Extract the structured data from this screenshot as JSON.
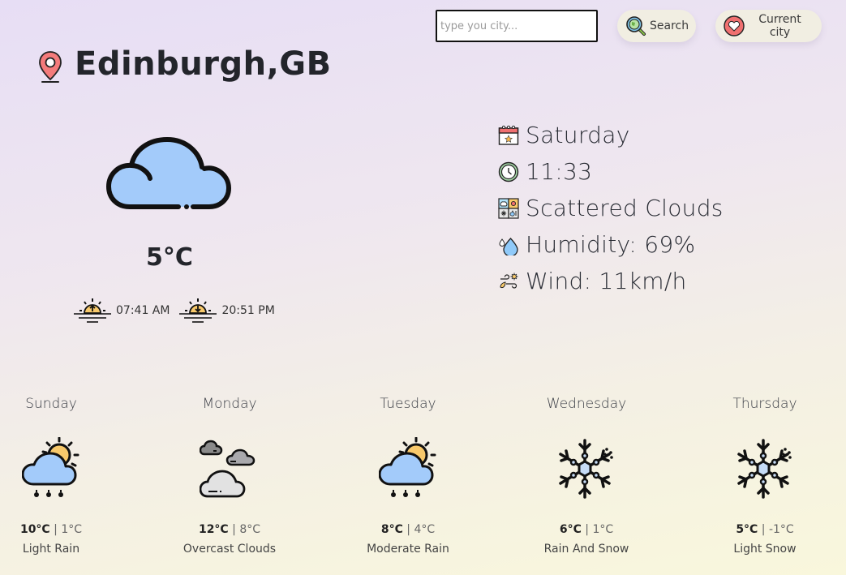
{
  "search": {
    "placeholder": "type you city...",
    "value": "",
    "search_label": "Search",
    "current_city_label": "Current city"
  },
  "location": {
    "title": "Edinburgh,GB"
  },
  "current": {
    "temperature": "5°C",
    "sunrise": "07:41 AM",
    "sunset": "20:51 PM",
    "day": "Saturday",
    "time": "11:33",
    "condition": "Scattered Clouds",
    "humidity": "Humidity: 69%",
    "wind": "Wind: 11km/h"
  },
  "forecast": [
    {
      "day": "Sunday",
      "high": "10°C",
      "low": "1°C",
      "desc": "Light Rain",
      "icon": "sun-cloud-rain-icon"
    },
    {
      "day": "Monday",
      "high": "12°C",
      "low": "8°C",
      "desc": "Overcast Clouds",
      "icon": "overcast-clouds-icon"
    },
    {
      "day": "Tuesday",
      "high": "8°C",
      "low": "4°C",
      "desc": "Moderate Rain",
      "icon": "sun-cloud-rain-icon"
    },
    {
      "day": "Wednesday",
      "high": "6°C",
      "low": "1°C",
      "desc": "Rain And Snow",
      "icon": "snowflake-icon"
    },
    {
      "day": "Thursday",
      "high": "5°C",
      "low": "-1°C",
      "desc": "Light Snow",
      "icon": "snowflake-icon"
    }
  ],
  "separator": "|",
  "colors": {
    "cloud_blue": "#a3cbfa",
    "sun_yellow": "#f8c96b",
    "pin_red": "#f47b7b",
    "pill_bg": "#f1eee2"
  }
}
